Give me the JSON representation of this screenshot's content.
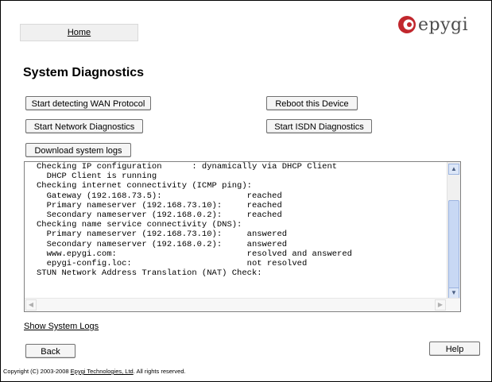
{
  "nav": {
    "home_label": "Home"
  },
  "logo": {
    "text": "epygi",
    "accent_color": "#c1272d"
  },
  "page": {
    "title": "System Diagnostics"
  },
  "buttons": {
    "wan_protocol": "Start detecting WAN Protocol",
    "reboot": "Reboot this Device",
    "network_diag": "Start Network Diagnostics",
    "isdn_diag": "Start ISDN Diagnostics",
    "download_logs": "Download system logs",
    "back": "Back",
    "help": "Help"
  },
  "log": {
    "lines": [
      "Checking IP configuration      : dynamically via DHCP Client",
      "  DHCP Client is running",
      "Checking internet connectivity (ICMP ping):",
      "  Gateway (192.168.73.5):                 reached",
      "  Primary nameserver (192.168.73.10):     reached",
      "  Secondary nameserver (192.168.0.2):     reached",
      "Checking name service connectivity (DNS):",
      "  Primary nameserver (192.168.73.10):     answered",
      "  Secondary nameserver (192.168.0.2):     answered",
      "  www.epygi.com:                          resolved and answered",
      "  epygi-config.loc:                       not resolved",
      "STUN Network Address Translation (NAT) Check:"
    ]
  },
  "links": {
    "show_logs": "Show System Logs"
  },
  "footer": {
    "prefix": "Copyright (C) 2003-2008 ",
    "company": "Epygi Technologies, Ltd",
    "suffix": ". All rights reserved."
  }
}
